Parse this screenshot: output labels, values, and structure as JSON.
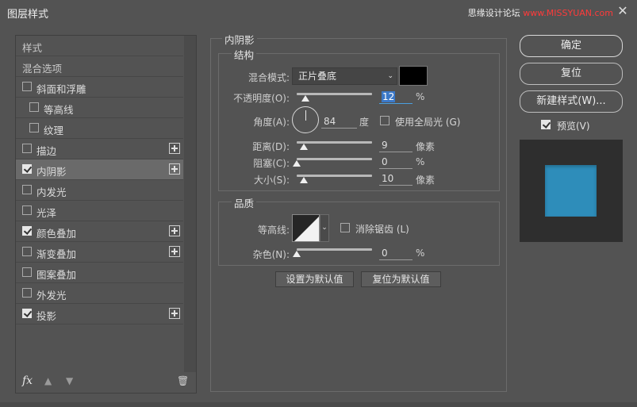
{
  "window": {
    "title": "图层样式",
    "watermark_a": "思缘设计论坛",
    "watermark_b": "www.MISSYUAN.com"
  },
  "left_panel": {
    "items": [
      {
        "label": "样式",
        "checkbox": false,
        "checked": false,
        "indent": 0,
        "plus": false,
        "selected": false,
        "header": true
      },
      {
        "label": "混合选项",
        "checkbox": false,
        "checked": false,
        "indent": 0,
        "plus": false,
        "selected": false,
        "header": true
      },
      {
        "label": "斜面和浮雕",
        "checkbox": true,
        "checked": false,
        "indent": 0,
        "plus": false,
        "selected": false
      },
      {
        "label": "等高线",
        "checkbox": true,
        "checked": false,
        "indent": 1,
        "plus": false,
        "selected": false
      },
      {
        "label": "纹理",
        "checkbox": true,
        "checked": false,
        "indent": 1,
        "plus": false,
        "selected": false
      },
      {
        "label": "描边",
        "checkbox": true,
        "checked": false,
        "indent": 0,
        "plus": true,
        "selected": false
      },
      {
        "label": "内阴影",
        "checkbox": true,
        "checked": true,
        "indent": 0,
        "plus": true,
        "selected": true
      },
      {
        "label": "内发光",
        "checkbox": true,
        "checked": false,
        "indent": 0,
        "plus": false,
        "selected": false
      },
      {
        "label": "光泽",
        "checkbox": true,
        "checked": false,
        "indent": 0,
        "plus": false,
        "selected": false
      },
      {
        "label": "颜色叠加",
        "checkbox": true,
        "checked": true,
        "indent": 0,
        "plus": true,
        "selected": false
      },
      {
        "label": "渐变叠加",
        "checkbox": true,
        "checked": false,
        "indent": 0,
        "plus": true,
        "selected": false
      },
      {
        "label": "图案叠加",
        "checkbox": true,
        "checked": false,
        "indent": 0,
        "plus": false,
        "selected": false
      },
      {
        "label": "外发光",
        "checkbox": true,
        "checked": false,
        "indent": 0,
        "plus": false,
        "selected": false
      },
      {
        "label": "投影",
        "checkbox": true,
        "checked": true,
        "indent": 0,
        "plus": true,
        "selected": false
      }
    ],
    "footer": {
      "fx": "fx",
      "up_icon": "arrow-up-icon",
      "down_icon": "arrow-down-icon",
      "trash_icon": "trash-icon"
    }
  },
  "inner_shadow": {
    "title": "内阴影",
    "structure": {
      "title": "结构",
      "blend_mode_label": "混合模式:",
      "blend_mode_value": "正片叠底",
      "shadow_color": "#000000",
      "opacity_label": "不透明度(O):",
      "opacity_value": "12",
      "opacity_unit": "%",
      "opacity_level": 0.12,
      "angle_label": "角度(A):",
      "angle_value": "84",
      "angle_unit": "度",
      "global_light_label": "使用全局光 (G)",
      "global_light_checked": false,
      "distance_label": "距离(D):",
      "distance_value": "9",
      "distance_unit": "像素",
      "distance_level": 0.09,
      "choke_label": "阻塞(C):",
      "choke_value": "0",
      "choke_unit": "%",
      "choke_level": 0.0,
      "size_label": "大小(S):",
      "size_value": "10",
      "size_unit": "像素",
      "size_level": 0.09
    },
    "quality": {
      "title": "品质",
      "contour_label": "等高线:",
      "antialias_label": "消除锯齿 (L)",
      "antialias_checked": false,
      "noise_label": "杂色(N):",
      "noise_value": "0",
      "noise_unit": "%",
      "noise_level": 0.0
    },
    "set_default_label": "设置为默认值",
    "reset_default_label": "复位为默认值"
  },
  "right_panel": {
    "ok_label": "确定",
    "reset_label": "复位",
    "new_style_label": "新建样式(W)...",
    "preview_label": "预览(V)",
    "preview_checked": true,
    "preview_bg": "#2e2e2e",
    "swatch_color": "#2e8dba"
  }
}
